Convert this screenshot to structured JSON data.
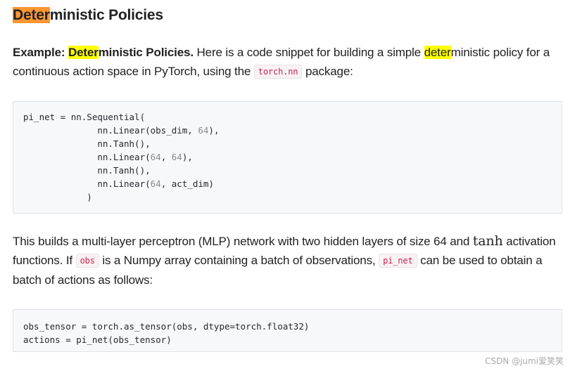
{
  "heading": {
    "hl": "Deter",
    "rest": "ministic Policies"
  },
  "para1": {
    "bold_a": "Example: ",
    "bold_hl": "Deter",
    "bold_b": "ministic Policies.",
    "text_a": " Here is a code snippet for building a simple ",
    "text_hl": "deter",
    "text_b": "ministic policy for a continuous action space in PyTorch, using the ",
    "code": "torch.nn",
    "text_c": " package:"
  },
  "code1": {
    "l1": "pi_net = nn.Sequential(",
    "l2a": "              nn.Linear(obs_dim, ",
    "l2n": "64",
    "l2b": "),",
    "l3": "              nn.Tanh(),",
    "l4a": "              nn.Linear(",
    "l4n1": "64",
    "l4m": ", ",
    "l4n2": "64",
    "l4b": "),",
    "l5": "              nn.Tanh(),",
    "l6a": "              nn.Linear(",
    "l6n": "64",
    "l6b": ", act_dim)",
    "l7": "            )"
  },
  "para2": {
    "text_a": "This builds a multi-layer perceptron (MLP) network with two hidden layers of size 64 and ",
    "math": "tanh",
    "text_b": " activation functions. If ",
    "code_obs": "obs",
    "text_c": " is a Numpy array containing a batch of observations, ",
    "code_pinet": "pi_net",
    "text_d": " can be used to obtain a batch of actions as follows:"
  },
  "code2": {
    "l1": "obs_tensor = torch.as_tensor(obs, dtype=torch.float32)",
    "l2": "actions = pi_net(obs_tensor)"
  },
  "watermark": "CSDN @jumi爱笑笑"
}
